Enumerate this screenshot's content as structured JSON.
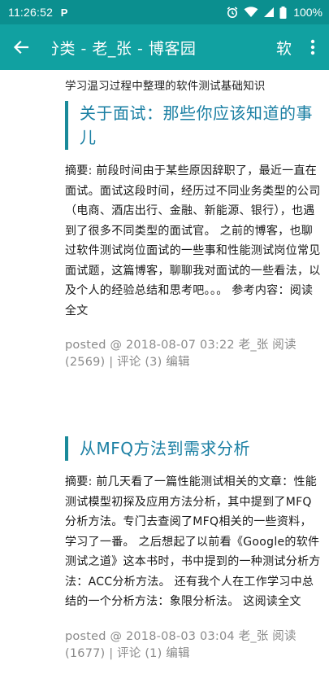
{
  "status_bar": {
    "time": "11:26:52",
    "app_indicator": "P",
    "battery": "100%",
    "icons": [
      "alarm-icon",
      "wifi-icon",
      "signal-icon",
      "battery-icon"
    ]
  },
  "app_bar": {
    "title": "分类 - 老_张 - 博客园",
    "action_label": "软",
    "colors": {
      "status_bar": "#0b8f8f",
      "app_bar": "#11a1a1"
    }
  },
  "category_description": "学习温习过程中整理的软件测试基础知识",
  "posts": [
    {
      "title": "关于面试：那些你应该知道的事儿",
      "abstract": "摘要: 前段时间由于某些原因辞职了，最近一直在面试。面试这段时间，经历过不同业务类型的公司（电商、酒店出行、金融、新能源、银行），也遇到了很多不同类型的面试官。 之前的博客，也聊过软件测试岗位面试的一些事和性能测试岗位常见面试题，这篇博客，聊聊我对面试的一些看法，以及个人的经验总结和思考吧。。。 参考内容：",
      "read_more": "阅读全文",
      "footer": "posted @ 2018-08-07 03:22 老_张 阅读(2569) | 评论 (3) 编辑"
    },
    {
      "title": "从MFQ方法到需求分析",
      "abstract": "摘要: 前几天看了一篇性能测试相关的文章：性能测试模型初探及应用方法分析，其中提到了MFQ分析方法。专门去查阅了MFQ相关的一些资料，学习了一番。 之后想起了以前看《Google的软件测试之道》这本书时，书中提到的一种测试分析方法：ACC分析方法。 还有我个人在工作学习中总结的一个分析方法：象限分析法。 这",
      "read_more": "阅读全文",
      "footer": "posted @ 2018-08-03 03:04 老_张 阅读(1677) | 评论 (1) 编辑"
    }
  ]
}
